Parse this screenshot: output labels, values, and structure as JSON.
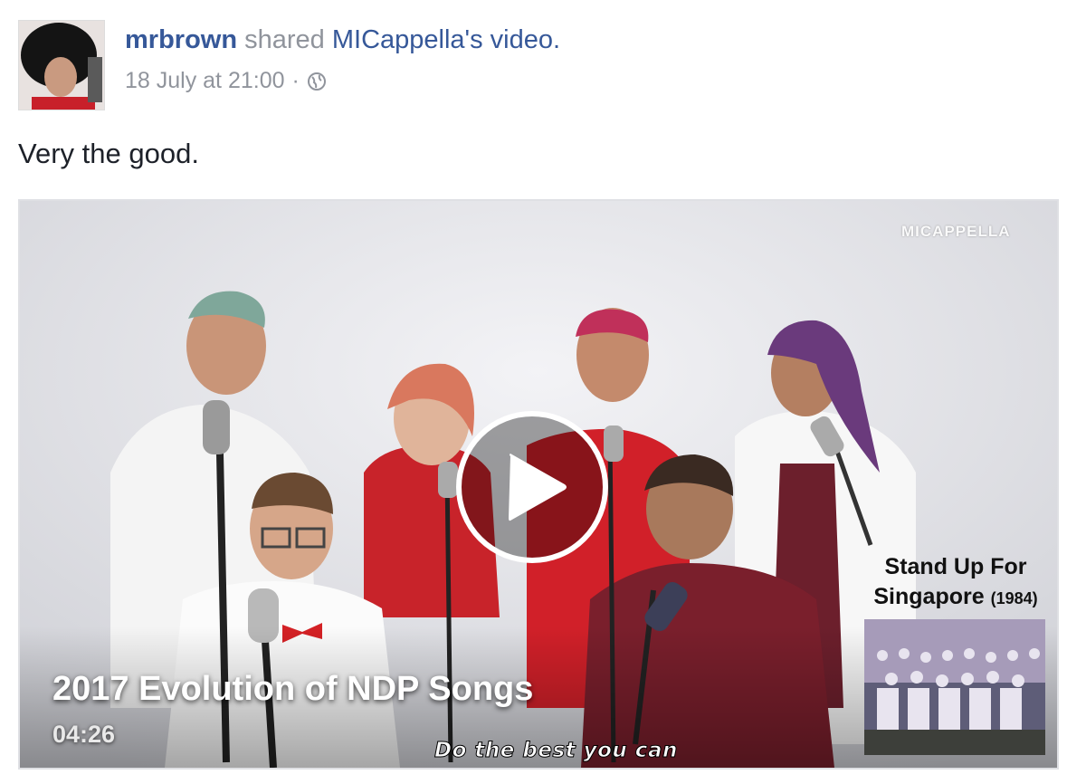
{
  "post": {
    "author": "mrbrown",
    "action_text": "shared",
    "shared_page": "MICappella's video.",
    "timestamp": "18 July at 21:00",
    "separator": "·",
    "privacy_icon": "globe-icon",
    "caption": "Very the good."
  },
  "video": {
    "title": "2017 Evolution of NDP Songs",
    "duration": "04:26",
    "subtitle": "Do the best you can",
    "watermark": "MICAPPELLA",
    "song_title": "Stand Up For",
    "song_title_line2": "Singapore",
    "song_year": "(1984)",
    "play_icon": "play-icon"
  },
  "colors": {
    "link": "#365899",
    "meta": "#90949c",
    "text": "#1d2129"
  }
}
